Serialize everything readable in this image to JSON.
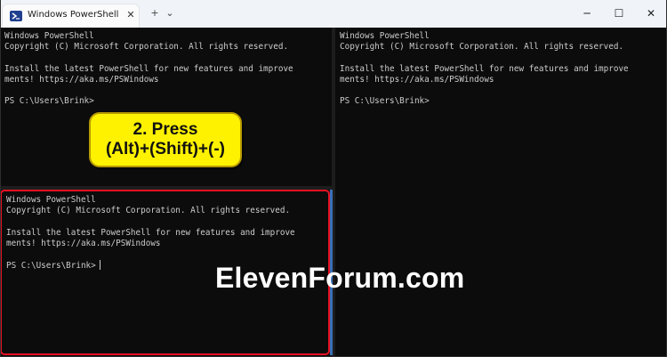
{
  "tab": {
    "title": "Windows PowerShell",
    "close_label": "✕",
    "icon": "powershell-icon"
  },
  "toolbar": {
    "new_tab_label": "+",
    "dropdown_label": "⌄"
  },
  "window_controls": {
    "minimize": "─",
    "maximize": "☐",
    "close": "✕"
  },
  "panes": {
    "left_top": {
      "lines": [
        "Windows PowerShell",
        "Copyright (C) Microsoft Corporation. All rights reserved.",
        "",
        "Install the latest PowerShell for new features and improve",
        "ments! https://aka.ms/PSWindows",
        "",
        "PS C:\\Users\\Brink>"
      ]
    },
    "right": {
      "lines": [
        "Windows PowerShell",
        "Copyright (C) Microsoft Corporation. All rights reserved.",
        "",
        "Install the latest PowerShell for new features and improve",
        "ments! https://aka.ms/PSWindows",
        "",
        "PS C:\\Users\\Brink>"
      ]
    },
    "left_bottom": {
      "lines": [
        "Windows PowerShell",
        "Copyright (C) Microsoft Corporation. All rights reserved.",
        "",
        "Install the latest PowerShell for new features and improve",
        "ments! https://aka.ms/PSWindows",
        "",
        "PS C:\\Users\\Brink>"
      ]
    }
  },
  "callout": {
    "line1": "2. Press",
    "line2": "(Alt)+(Shift)+(-)"
  },
  "watermark": "ElevenForum.com",
  "colors": {
    "terminal_bg": "#0c0c0c",
    "terminal_fg": "#cccccc",
    "focus_border": "#e81123",
    "callout_bg": "#fff200"
  }
}
